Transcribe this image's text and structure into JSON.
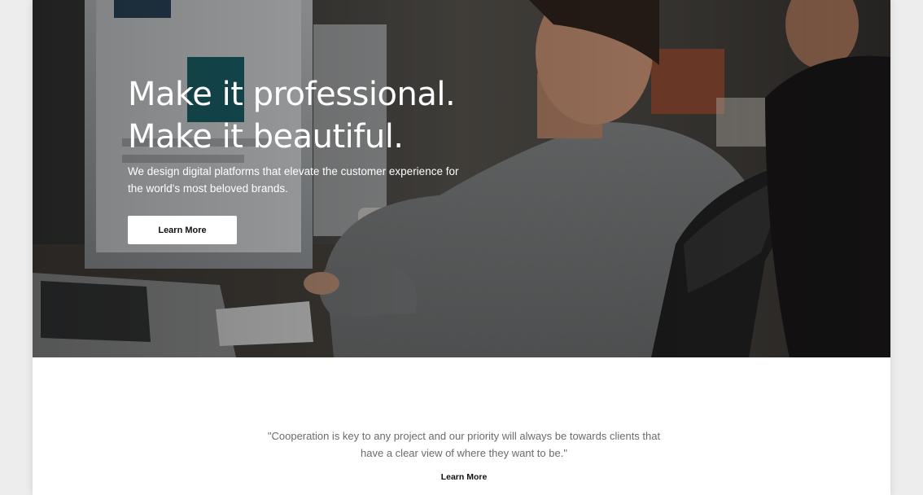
{
  "hero": {
    "title_line1": "Make it professional.",
    "title_line2": "Make it beautiful.",
    "subtitle": "We design digital platforms that elevate the customer experience for the world's most beloved brands.",
    "button_label": "Learn More"
  },
  "testimonial": {
    "quote": "\"Cooperation is key to any project and our priority will always be towards clients that have a clear view of where they want to be.\"",
    "link_label": "Learn More"
  },
  "scroll_top": {
    "icon": "chevron-up-icon"
  },
  "colors": {
    "page_background": "#ededed",
    "content_background": "#ffffff",
    "hero_text": "#ffffff",
    "button_background": "#ffffff",
    "quote_text": "#6b6b6b"
  }
}
